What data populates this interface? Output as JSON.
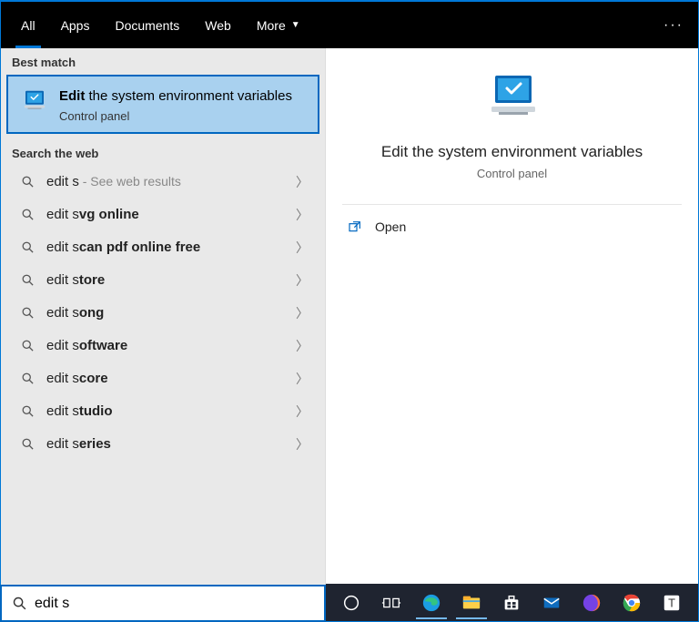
{
  "tabs": {
    "all": "All",
    "apps": "Apps",
    "documents": "Documents",
    "web": "Web",
    "more": "More"
  },
  "sections": {
    "best_match": "Best match",
    "search_web": "Search the web"
  },
  "best_match": {
    "title_bold": "Edit",
    "title_rest": " the system environment variables",
    "subtitle": "Control panel"
  },
  "web_results": [
    {
      "prefix": "edit s",
      "bold": "",
      "hint": " - See web results"
    },
    {
      "prefix": "edit s",
      "bold": "vg online",
      "hint": ""
    },
    {
      "prefix": "edit s",
      "bold": "can pdf online free",
      "hint": ""
    },
    {
      "prefix": "edit s",
      "bold": "tore",
      "hint": ""
    },
    {
      "prefix": "edit s",
      "bold": "ong",
      "hint": ""
    },
    {
      "prefix": "edit s",
      "bold": "oftware",
      "hint": ""
    },
    {
      "prefix": "edit s",
      "bold": "core",
      "hint": ""
    },
    {
      "prefix": "edit s",
      "bold": "tudio",
      "hint": ""
    },
    {
      "prefix": "edit s",
      "bold": "eries",
      "hint": ""
    }
  ],
  "preview": {
    "title": "Edit the system environment variables",
    "subtitle": "Control panel",
    "open": "Open"
  },
  "search": {
    "value": "edit s",
    "placeholder": ""
  }
}
